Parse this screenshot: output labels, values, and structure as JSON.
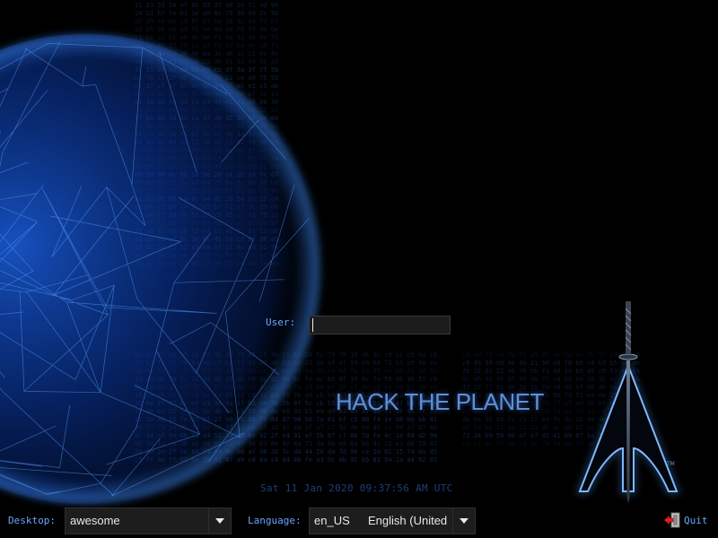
{
  "login": {
    "user_label": "User:",
    "user_value": ""
  },
  "tagline": "HACK THE PLANET",
  "clock": "Sat 11 Jan 2020 09:37:56 AM UTC",
  "bottom_bar": {
    "desktop_label": "Desktop:",
    "desktop_value": "awesome",
    "language_label": "Language:",
    "language_code": "en_US",
    "language_name": "English (United",
    "quit_label": "Quit"
  },
  "icons": {
    "globe": "network-globe-art",
    "logo": "arch-sword-logo",
    "quit": "exit-door-icon",
    "dropdown": "chevron-down-icon"
  },
  "colors": {
    "background": "#000000",
    "label": "#6aa6ff",
    "tagline": "#5e8fd8",
    "clock": "#1f3f7a",
    "globe": "#2f7bff",
    "field_bg": "#1c1c1c"
  }
}
